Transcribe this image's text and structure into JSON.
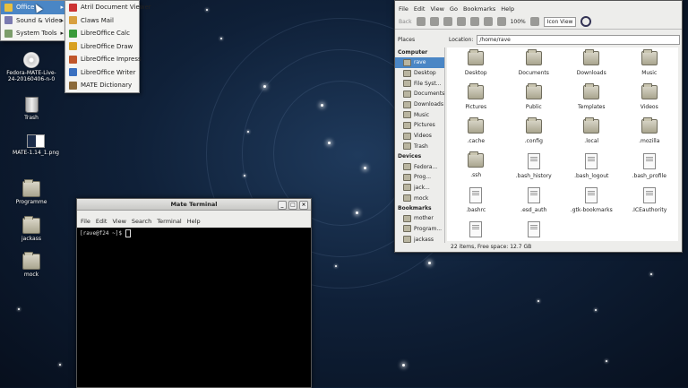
{
  "menu": {
    "categories": [
      {
        "label": "Office",
        "icon": "office-icon",
        "active": true
      },
      {
        "label": "Sound & Video",
        "icon": "sound-video-icon"
      },
      {
        "label": "System Tools",
        "icon": "system-tools-icon"
      }
    ],
    "submenu": [
      {
        "label": "Atril Document Viewer",
        "icon": "document-viewer-icon"
      },
      {
        "label": "Claws Mail",
        "icon": "mail-icon"
      },
      {
        "label": "LibreOffice Calc",
        "icon": "spreadsheet-icon"
      },
      {
        "label": "LibreOffice Draw",
        "icon": "draw-icon"
      },
      {
        "label": "LibreOffice Impress",
        "icon": "presentation-icon"
      },
      {
        "label": "LibreOffice Writer",
        "icon": "writer-icon"
      },
      {
        "label": "MATE Dictionary",
        "icon": "dictionary-icon"
      }
    ],
    "arrow": "▸"
  },
  "desktop": {
    "icons": [
      {
        "label": "Fedora-MATE-Live-24-20160406-n-0",
        "icon": "disc-icon"
      },
      {
        "label": "Trash",
        "icon": "trash-icon"
      },
      {
        "label": "MATE-1.14_1.png",
        "icon": "image-file-icon"
      },
      {
        "label": "Programme",
        "icon": "folder-icon"
      },
      {
        "label": "jackass",
        "icon": "folder-icon"
      },
      {
        "label": "mock",
        "icon": "folder-icon"
      }
    ]
  },
  "terminal": {
    "title": "Mate Terminal",
    "menu": [
      "File",
      "Edit",
      "View",
      "Search",
      "Terminal",
      "Help"
    ],
    "prompt": "[rave@f24 ~]$ ",
    "buttons": {
      "minimize": "_",
      "maximize": "□",
      "close": "×"
    }
  },
  "file_manager": {
    "menu": [
      "File",
      "Edit",
      "View",
      "Go",
      "Bookmarks",
      "Help"
    ],
    "toolbar": {
      "back": "Back",
      "zoom": "100%",
      "view_mode": "Icon View"
    },
    "location_label": "Location:",
    "location": "/home/rave",
    "places_label": "Places",
    "sections": [
      {
        "title": "Computer",
        "items": [
          {
            "label": "rave",
            "active": true
          },
          {
            "label": "Desktop"
          },
          {
            "label": "File Syst..."
          },
          {
            "label": "Documents"
          },
          {
            "label": "Downloads"
          },
          {
            "label": "Music"
          },
          {
            "label": "Pictures"
          },
          {
            "label": "Videos"
          },
          {
            "label": "Trash"
          }
        ]
      },
      {
        "title": "Devices",
        "items": [
          {
            "label": "Fedora..."
          },
          {
            "label": "Prog..."
          },
          {
            "label": "jack..."
          },
          {
            "label": "mock"
          }
        ]
      },
      {
        "title": "Bookmarks",
        "items": [
          {
            "label": "mother"
          },
          {
            "label": "Program..."
          },
          {
            "label": "jackass"
          }
        ]
      }
    ],
    "files": [
      {
        "name": "Desktop",
        "kind": "folder"
      },
      {
        "name": "Documents",
        "kind": "folder"
      },
      {
        "name": "Downloads",
        "kind": "folder"
      },
      {
        "name": "Music",
        "kind": "folder"
      },
      {
        "name": "Pictures",
        "kind": "folder"
      },
      {
        "name": "Public",
        "kind": "folder"
      },
      {
        "name": "Templates",
        "kind": "folder"
      },
      {
        "name": "Videos",
        "kind": "folder"
      },
      {
        "name": ".cache",
        "kind": "folder"
      },
      {
        "name": ".config",
        "kind": "folder"
      },
      {
        "name": ".local",
        "kind": "folder"
      },
      {
        "name": ".mozilla",
        "kind": "folder"
      },
      {
        "name": ".ssh",
        "kind": "folder"
      },
      {
        "name": ".bash_history",
        "kind": "file"
      },
      {
        "name": ".bash_logout",
        "kind": "file"
      },
      {
        "name": ".bash_profile",
        "kind": "file"
      },
      {
        "name": ".bashrc",
        "kind": "file"
      },
      {
        "name": ".esd_auth",
        "kind": "file"
      },
      {
        "name": ".gtk-bookmarks",
        "kind": "file"
      },
      {
        "name": ".ICEauthority",
        "kind": "file"
      },
      {
        "name": "",
        "kind": "file"
      },
      {
        "name": "",
        "kind": "file"
      }
    ],
    "status": "22 items, Free space: 12.7 GB"
  },
  "colors": {
    "accent": "#4a86c5",
    "desktop_bg": "#0f2038"
  }
}
